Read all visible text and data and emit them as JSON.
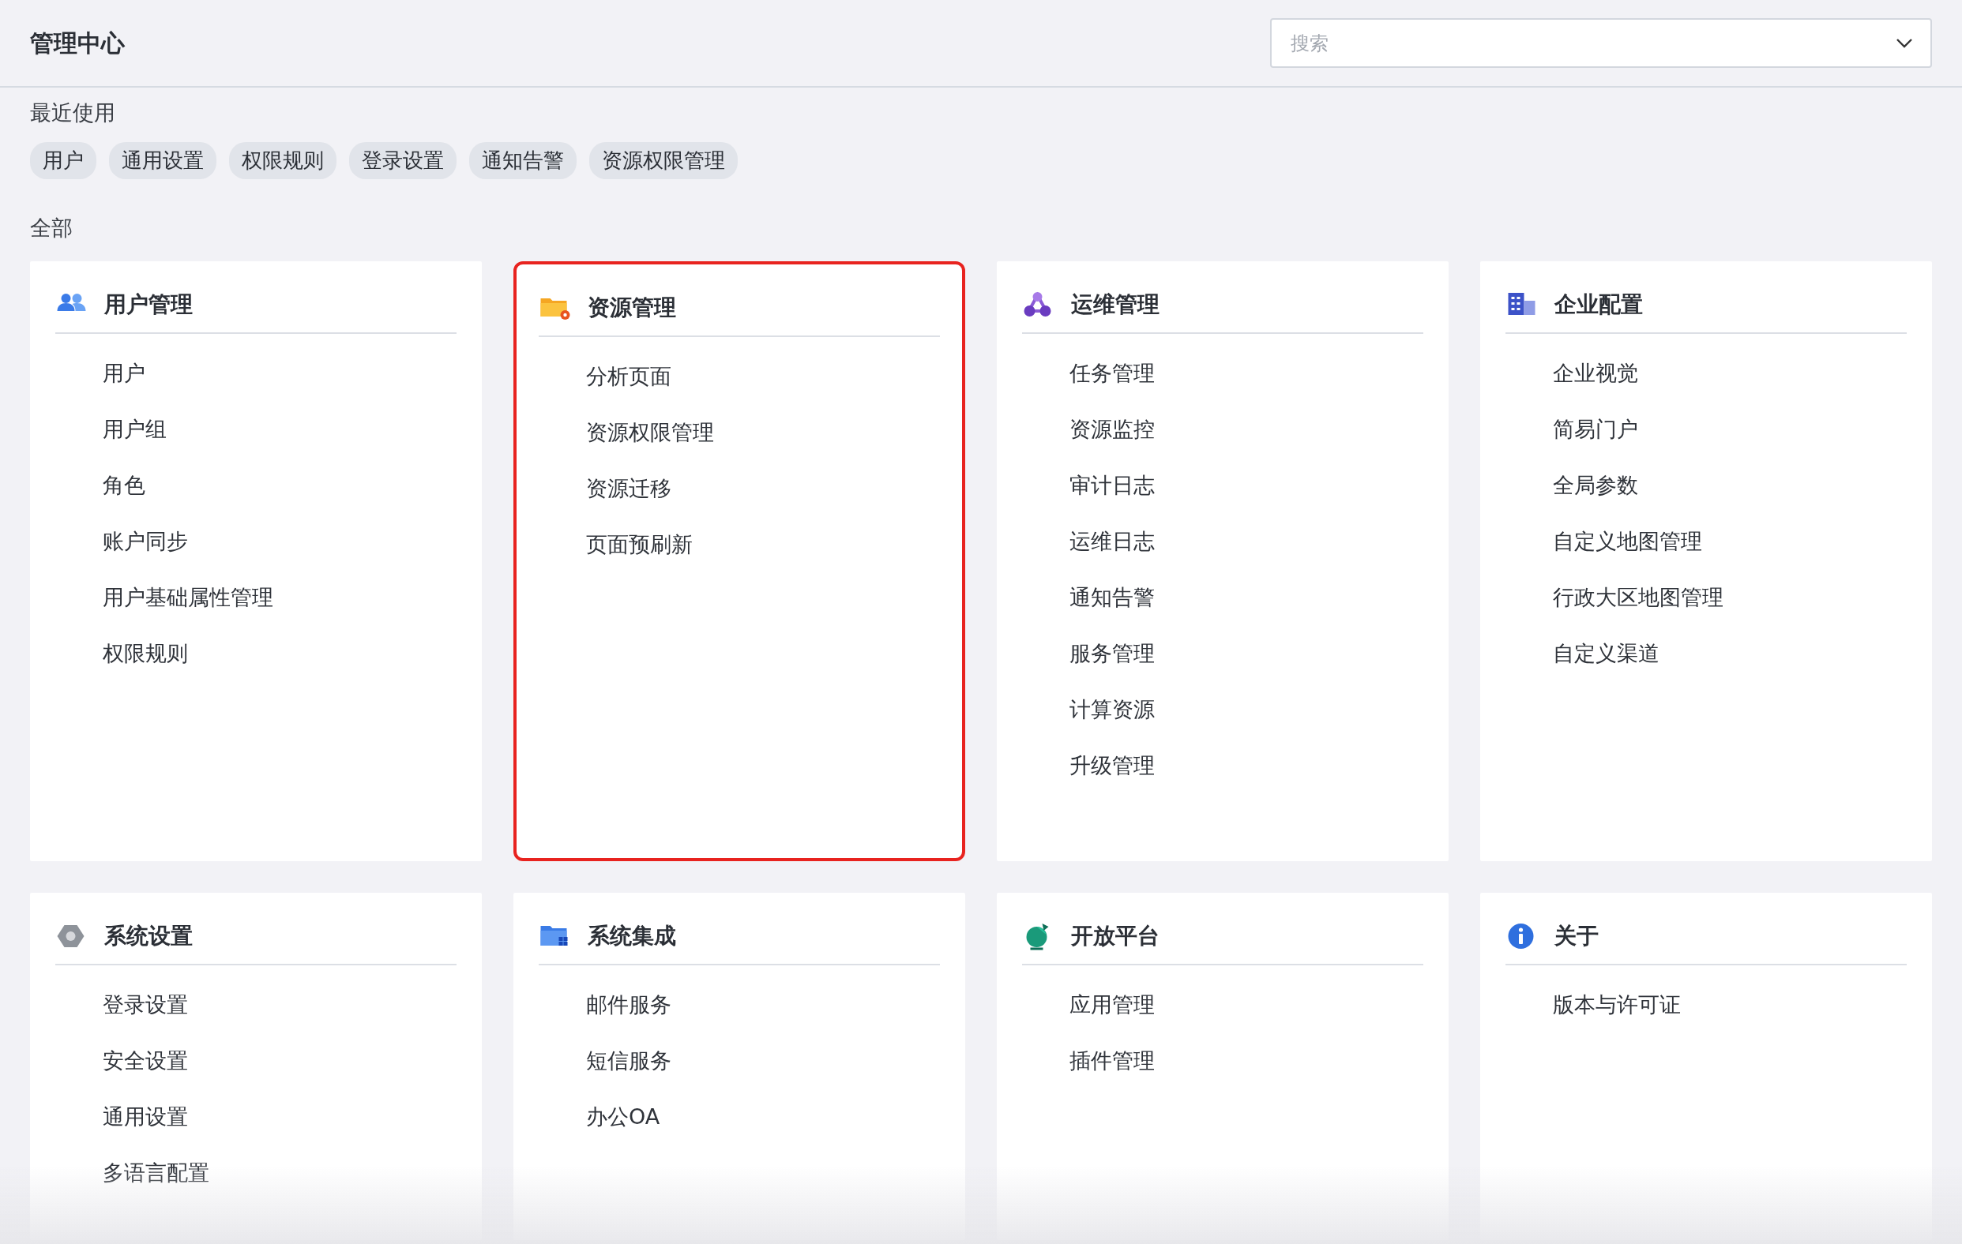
{
  "header": {
    "title": "管理中心",
    "search": {
      "placeholder": "搜索"
    }
  },
  "recent": {
    "label": "最近使用",
    "chips": [
      "用户",
      "通用设置",
      "权限规则",
      "登录设置",
      "通知告警",
      "资源权限管理"
    ]
  },
  "all_label": "全部",
  "cards": [
    {
      "title": "用户管理",
      "highlighted": false,
      "items": [
        "用户",
        "用户组",
        "角色",
        "账户同步",
        "用户基础属性管理",
        "权限规则"
      ]
    },
    {
      "title": "资源管理",
      "highlighted": true,
      "items": [
        "分析页面",
        "资源权限管理",
        "资源迁移",
        "页面预刷新"
      ]
    },
    {
      "title": "运维管理",
      "highlighted": false,
      "items": [
        "任务管理",
        "资源监控",
        "审计日志",
        "运维日志",
        "通知告警",
        "服务管理",
        "计算资源",
        "升级管理"
      ]
    },
    {
      "title": "企业配置",
      "highlighted": false,
      "items": [
        "企业视觉",
        "简易门户",
        "全局参数",
        "自定义地图管理",
        "行政大区地图管理",
        "自定义渠道"
      ]
    },
    {
      "title": "系统设置",
      "highlighted": false,
      "items": [
        "登录设置",
        "安全设置",
        "通用设置",
        "多语言配置"
      ]
    },
    {
      "title": "系统集成",
      "highlighted": false,
      "items": [
        "邮件服务",
        "短信服务",
        "办公OA"
      ]
    },
    {
      "title": "开放平台",
      "highlighted": false,
      "items": [
        "应用管理",
        "插件管理"
      ]
    },
    {
      "title": "关于",
      "highlighted": false,
      "items": [
        "版本与许可证"
      ]
    }
  ]
}
